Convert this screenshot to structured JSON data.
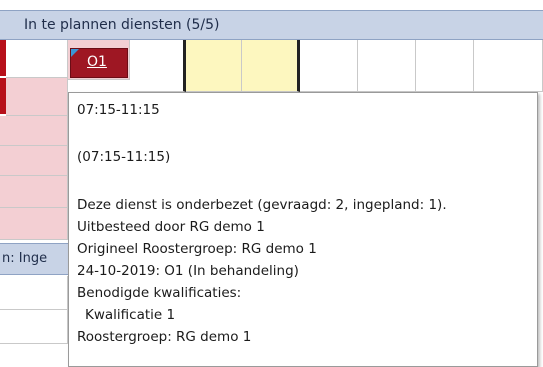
{
  "panel": {
    "title": "In te plannen diensten (5/5)"
  },
  "service_cell": {
    "label": "O1"
  },
  "second_panel": {
    "title_fragment": "n: Inge"
  },
  "tooltip": {
    "time_range": "07:15-11:15",
    "time_range_paren": "(07:15-11:15)",
    "understaffed": "Deze dienst is onderbezet (gevraagd: 2, ingepland: 1).",
    "outsourced": "Uitbesteed door RG demo 1",
    "original_group": "Origineel Roostergroep: RG demo 1",
    "date_status": "24-10-2019: O1 (In behandeling)",
    "qualifications_label": "Benodigde kwalificaties:",
    "qualification_1": "Kwalificatie 1",
    "roster_group": "Roostergroep: RG demo 1"
  },
  "colors": {
    "header_bg": "#c8d3e6",
    "service_cell_bg": "#9e1723",
    "highlight_yellow": "#fdf7bf",
    "row_pink": "#f3cfd3"
  }
}
